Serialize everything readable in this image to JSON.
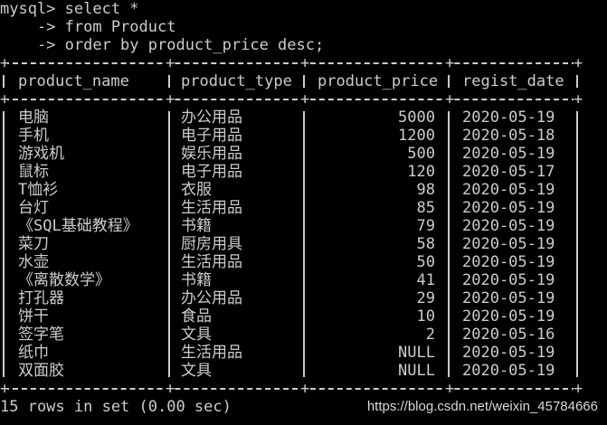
{
  "console": {
    "prompt_line": "mysql> select *",
    "line2": "    -> from Product",
    "line3": "    -> order by product_price desc;"
  },
  "table": {
    "columns": [
      "product_name",
      "product_type",
      "product_price",
      "regist_date"
    ],
    "rows": [
      [
        "电脑",
        "办公用品",
        "5000",
        "2020-05-19"
      ],
      [
        "手机",
        "电子用品",
        "1200",
        "2020-05-18"
      ],
      [
        "游戏机",
        "娱乐用品",
        "500",
        "2020-05-19"
      ],
      [
        "鼠标",
        "电子用品",
        "120",
        "2020-05-17"
      ],
      [
        "T恤衫",
        "衣服",
        "98",
        "2020-05-19"
      ],
      [
        "台灯",
        "生活用品",
        "85",
        "2020-05-19"
      ],
      [
        "《SQL基础教程》",
        "书籍",
        "79",
        "2020-05-19"
      ],
      [
        "菜刀",
        "厨房用具",
        "58",
        "2020-05-19"
      ],
      [
        "水壶",
        "生活用品",
        "50",
        "2020-05-19"
      ],
      [
        "《离散数学》",
        "书籍",
        "41",
        "2020-05-19"
      ],
      [
        "打孔器",
        "办公用品",
        "29",
        "2020-05-19"
      ],
      [
        "饼干",
        "食品",
        "10",
        "2020-05-19"
      ],
      [
        "签字笔",
        "文具",
        "2",
        "2020-05-16"
      ],
      [
        "纸巾",
        "生活用品",
        "NULL",
        "2020-05-19"
      ],
      [
        "双面胶",
        "文具",
        "NULL",
        "2020-05-19"
      ]
    ]
  },
  "footer": {
    "summary": "15 rows in set (0.00 sec)",
    "watermark": "https://blog.csdn.net/weixin_45784666"
  },
  "colors": {
    "background": "#000000",
    "text": "#cccccc"
  }
}
